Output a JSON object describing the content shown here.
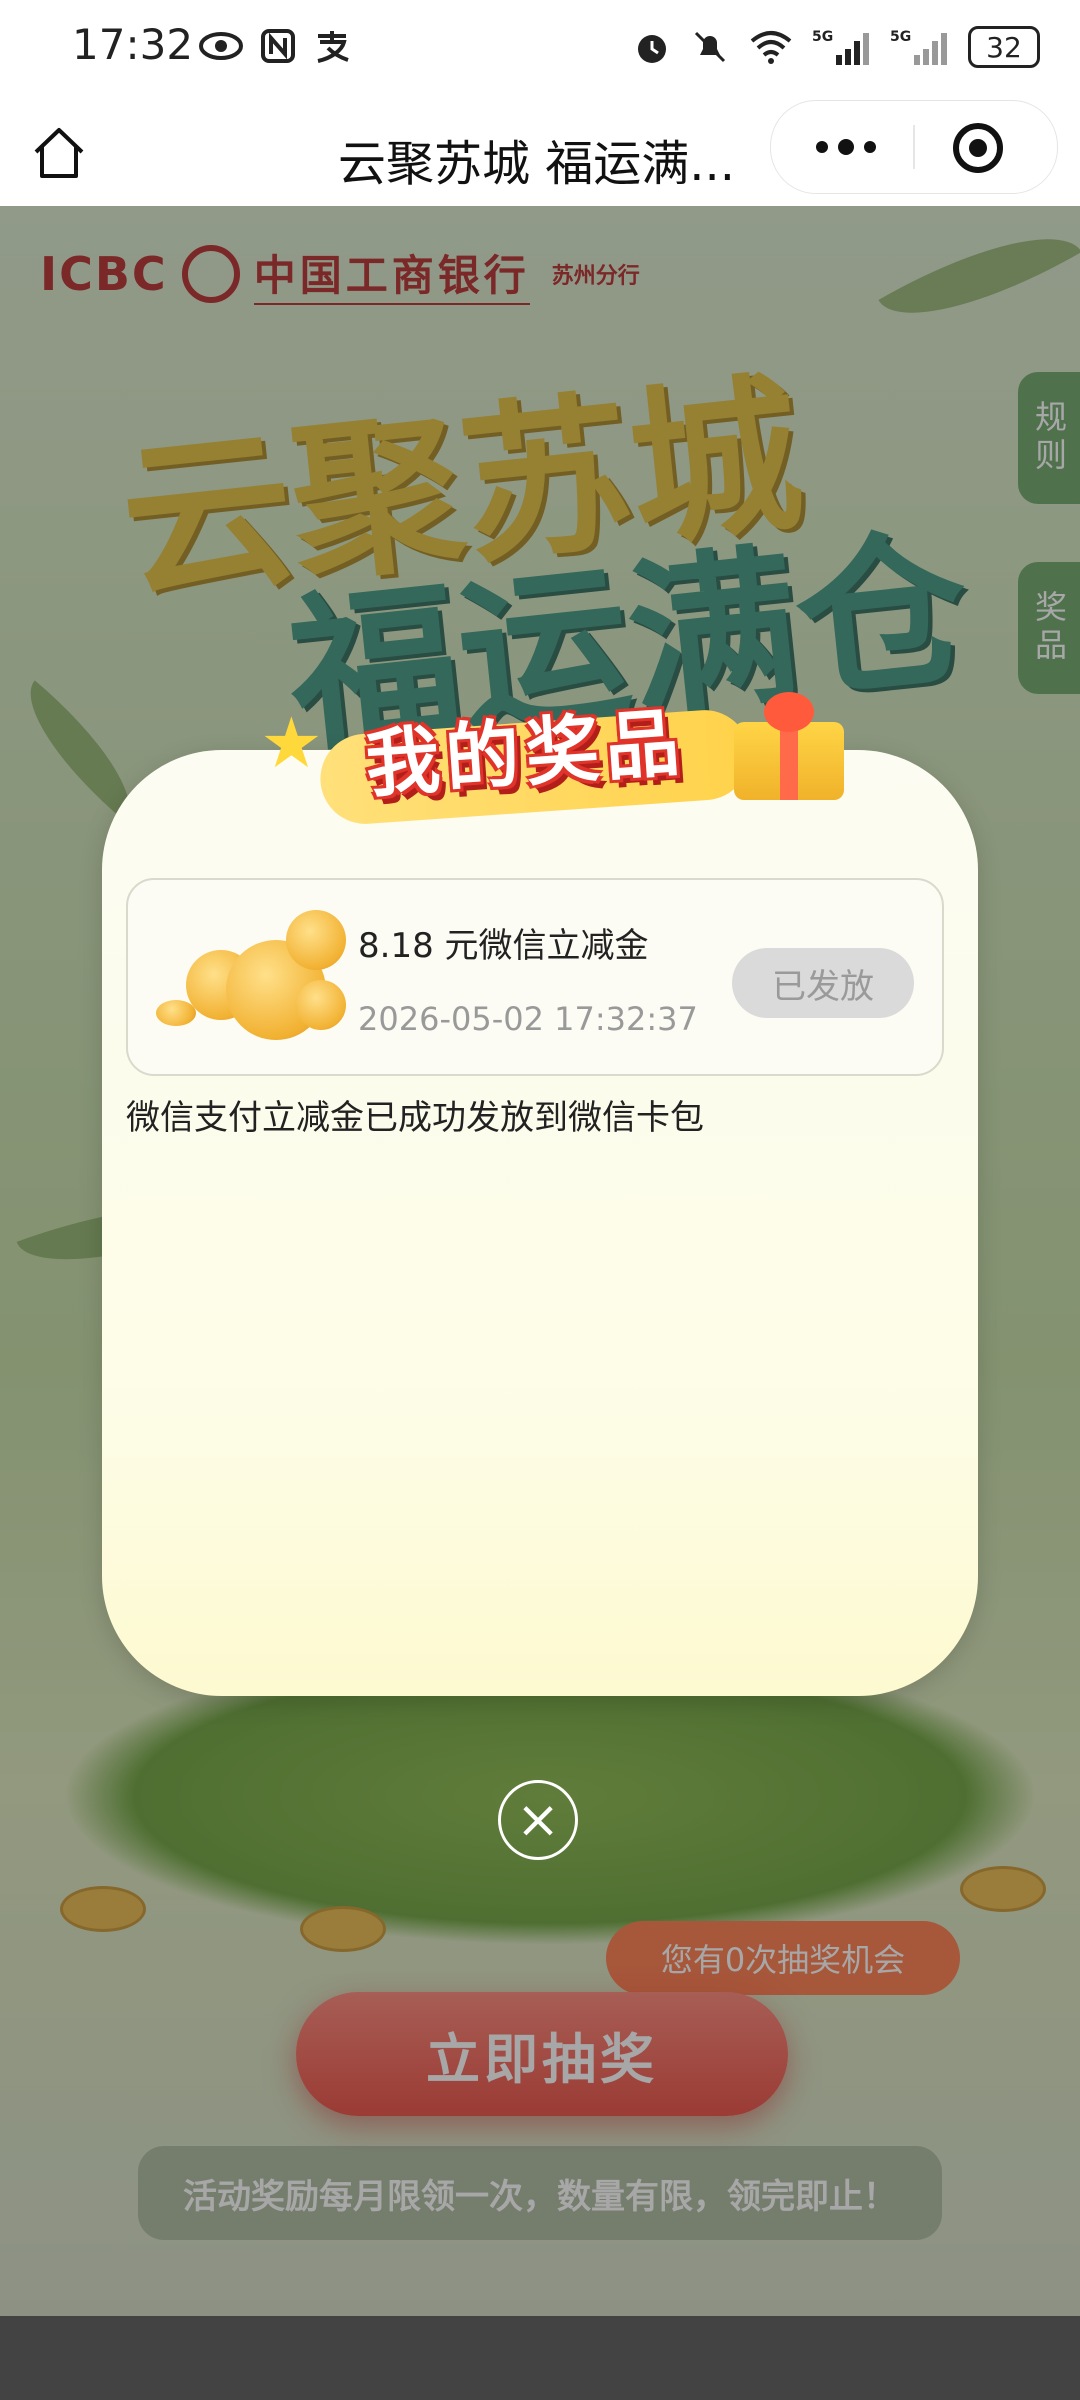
{
  "status_bar": {
    "time": "17:32",
    "battery": "32",
    "net1": "5G",
    "net2": "5G",
    "left_icons": [
      "eye-icon",
      "nfc-icon",
      "alipay-icon"
    ],
    "right_icons": [
      "alarm-icon",
      "mute-bell-icon",
      "wifi-icon",
      "signal-icon",
      "signal-icon",
      "battery-icon"
    ]
  },
  "titlebar": {
    "title": "云聚苏城 福运满..."
  },
  "page": {
    "bank_brand": "ICBC",
    "bank_name": "中国工商银行",
    "bank_branch": "苏州分行",
    "hero_line1": "云聚苏城",
    "hero_line2": "福运满仓",
    "side_tabs": [
      "规则",
      "奖品"
    ],
    "draw_button": "立即抽奖",
    "chance_text": "您有0次抽奖机会",
    "notice": "活动奖励每月限领一次，数量有限，领完即止！"
  },
  "modal": {
    "title": "我的奖品",
    "prize": {
      "name": "8.18 元微信立减金",
      "time": "2026-05-02 17:32:37",
      "status": "已发放"
    },
    "desc": "微信支付立减金已成功发放到微信卡包",
    "close_icon": "close-icon"
  },
  "colors": {
    "brand_red": "#b01818",
    "button_red": "#e93b2f",
    "modal_bg": "#fcfcf2",
    "status_gray": "#dadada"
  }
}
